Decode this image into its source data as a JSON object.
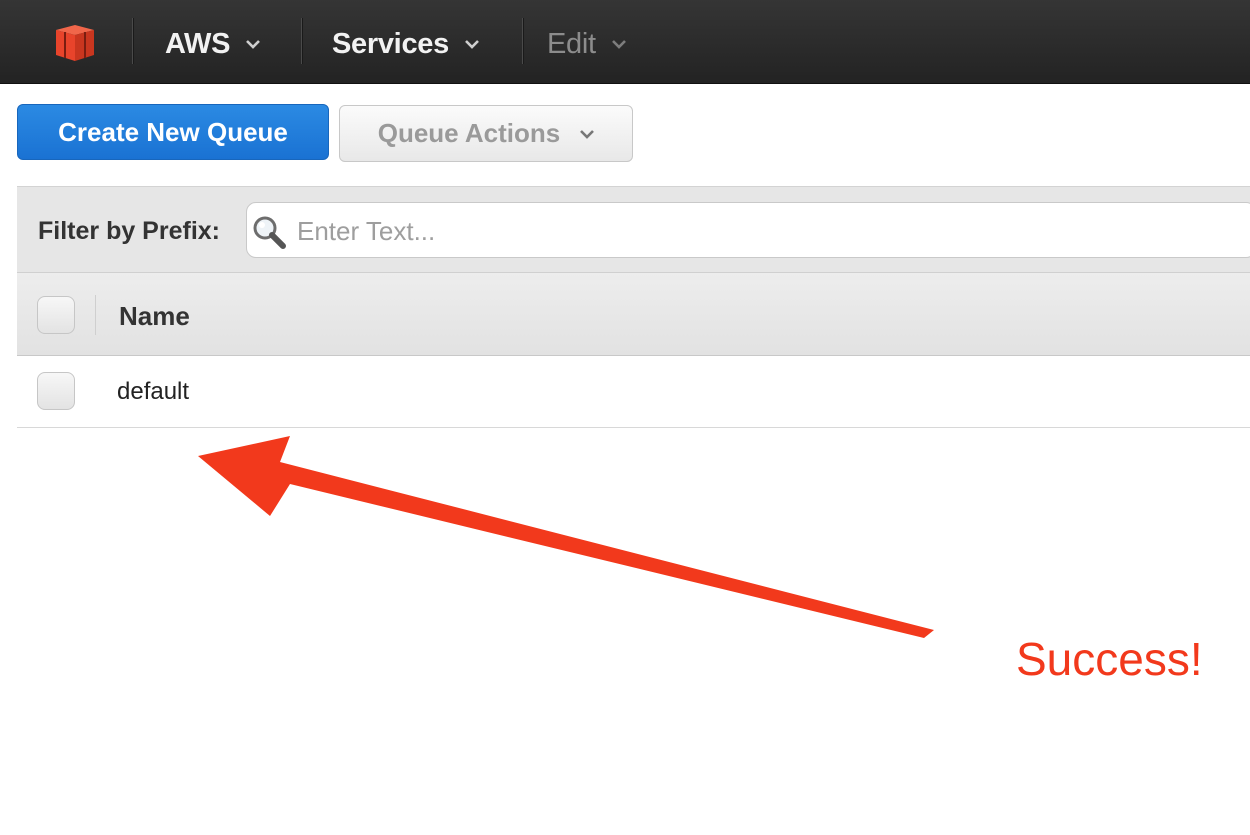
{
  "nav": {
    "aws_label": "AWS",
    "services_label": "Services",
    "edit_label": "Edit",
    "logo_icon": "aws-cube-icon",
    "logo_color": "#e8442b"
  },
  "toolbar": {
    "create_label": "Create New Queue",
    "actions_label": "Queue Actions",
    "primary_color": "#1f7bd9"
  },
  "filter": {
    "label": "Filter by Prefix:",
    "placeholder": "Enter Text...",
    "value": "",
    "icon": "search-icon"
  },
  "table": {
    "columns": [
      "Name"
    ],
    "rows": [
      {
        "name": "default",
        "selected": false
      }
    ]
  },
  "annotation": {
    "text": "Success!",
    "color": "#f2391c",
    "arrow_icon": "arrow-icon"
  }
}
